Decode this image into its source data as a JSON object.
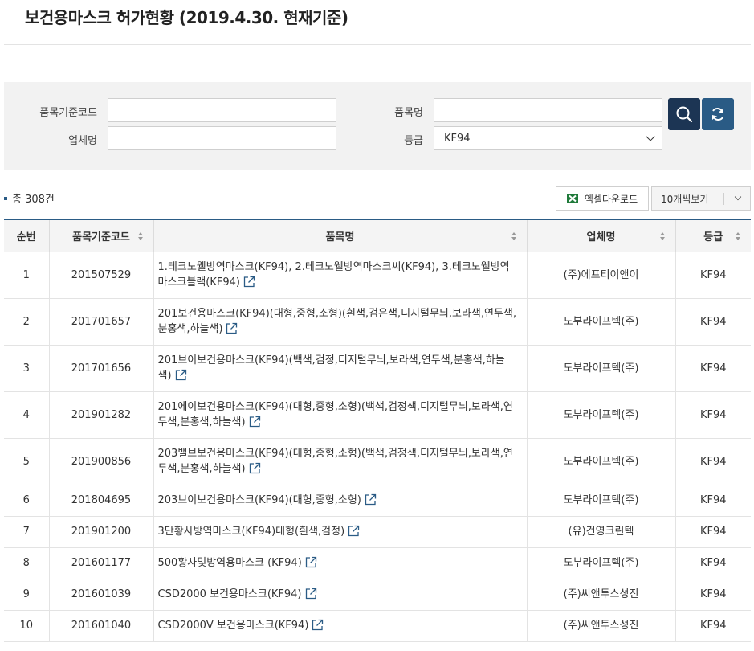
{
  "page": {
    "title": "보건용마스크 허가현황 (2019.4.30. 현재기준)"
  },
  "search": {
    "code_label": "품목기준코드",
    "code_value": "",
    "name_label": "품목명",
    "name_value": "",
    "company_label": "업체명",
    "company_value": "",
    "grade_label": "등급",
    "grade_value": "KF94",
    "search_icon": "search-icon",
    "refresh_icon": "refresh-icon"
  },
  "summary": {
    "total": "총 308건"
  },
  "toolbar": {
    "excel_label": "엑셀다운로드",
    "perpage_label": "10개씩보기"
  },
  "colors": {
    "primary": "#2a5b85",
    "search_button": "#1c3554",
    "excel_green": "#1f7a3a"
  },
  "table": {
    "headers": [
      "순번",
      "품목기준코드",
      "품목명",
      "업체명",
      "등급"
    ],
    "rows": [
      {
        "no": "1",
        "code": "201507529",
        "name": "1.테크노웰방역마스크(KF94), 2.테크노웰방역마스크씨(KF94), 3.테크노웰방역마스크블랙(KF94)",
        "company": "(주)에프티이앤이",
        "grade": "KF94"
      },
      {
        "no": "2",
        "code": "201701657",
        "name": "201보건용마스크(KF94)(대형,중형,소형)(흰색,검은색,디지털무늬,보라색,연두색,분홍색,하늘색)",
        "company": "도부라이프텍(주)",
        "grade": "KF94"
      },
      {
        "no": "3",
        "code": "201701656",
        "name": "201브이보건용마스크(KF94)(백색,검정,디지털무늬,보라색,연두색,분홍색,하늘색)",
        "company": "도부라이프텍(주)",
        "grade": "KF94"
      },
      {
        "no": "4",
        "code": "201901282",
        "name": "201에이보건용마스크(KF94)(대형,중형,소형)(백색,검정색,디지털무늬,보라색,연두색,분홍색,하늘색)",
        "company": "도부라이프텍(주)",
        "grade": "KF94"
      },
      {
        "no": "5",
        "code": "201900856",
        "name": "203밸브보건용마스크(KF94)(대형,중형,소형)(백색,검정색,디지털무늬,보라색,연두색,분홍색,하늘색)",
        "company": "도부라이프텍(주)",
        "grade": "KF94"
      },
      {
        "no": "6",
        "code": "201804695",
        "name": "203브이보건용마스크(KF94)(대형,중형,소형)",
        "company": "도부라이프텍(주)",
        "grade": "KF94"
      },
      {
        "no": "7",
        "code": "201901200",
        "name": "3단황사방역마스크(KF94)대형(흰색,검정)",
        "company": "(유)건영크린텍",
        "grade": "KF94"
      },
      {
        "no": "8",
        "code": "201601177",
        "name": "500황사및방역용마스크 (KF94)",
        "company": "도부라이프텍(주)",
        "grade": "KF94"
      },
      {
        "no": "9",
        "code": "201601039",
        "name": "CSD2000 보건용마스크(KF94)",
        "company": "(주)씨앤투스성진",
        "grade": "KF94"
      },
      {
        "no": "10",
        "code": "201601040",
        "name": "CSD2000V 보건용마스크(KF94)",
        "company": "(주)씨앤투스성진",
        "grade": "KF94"
      }
    ]
  }
}
